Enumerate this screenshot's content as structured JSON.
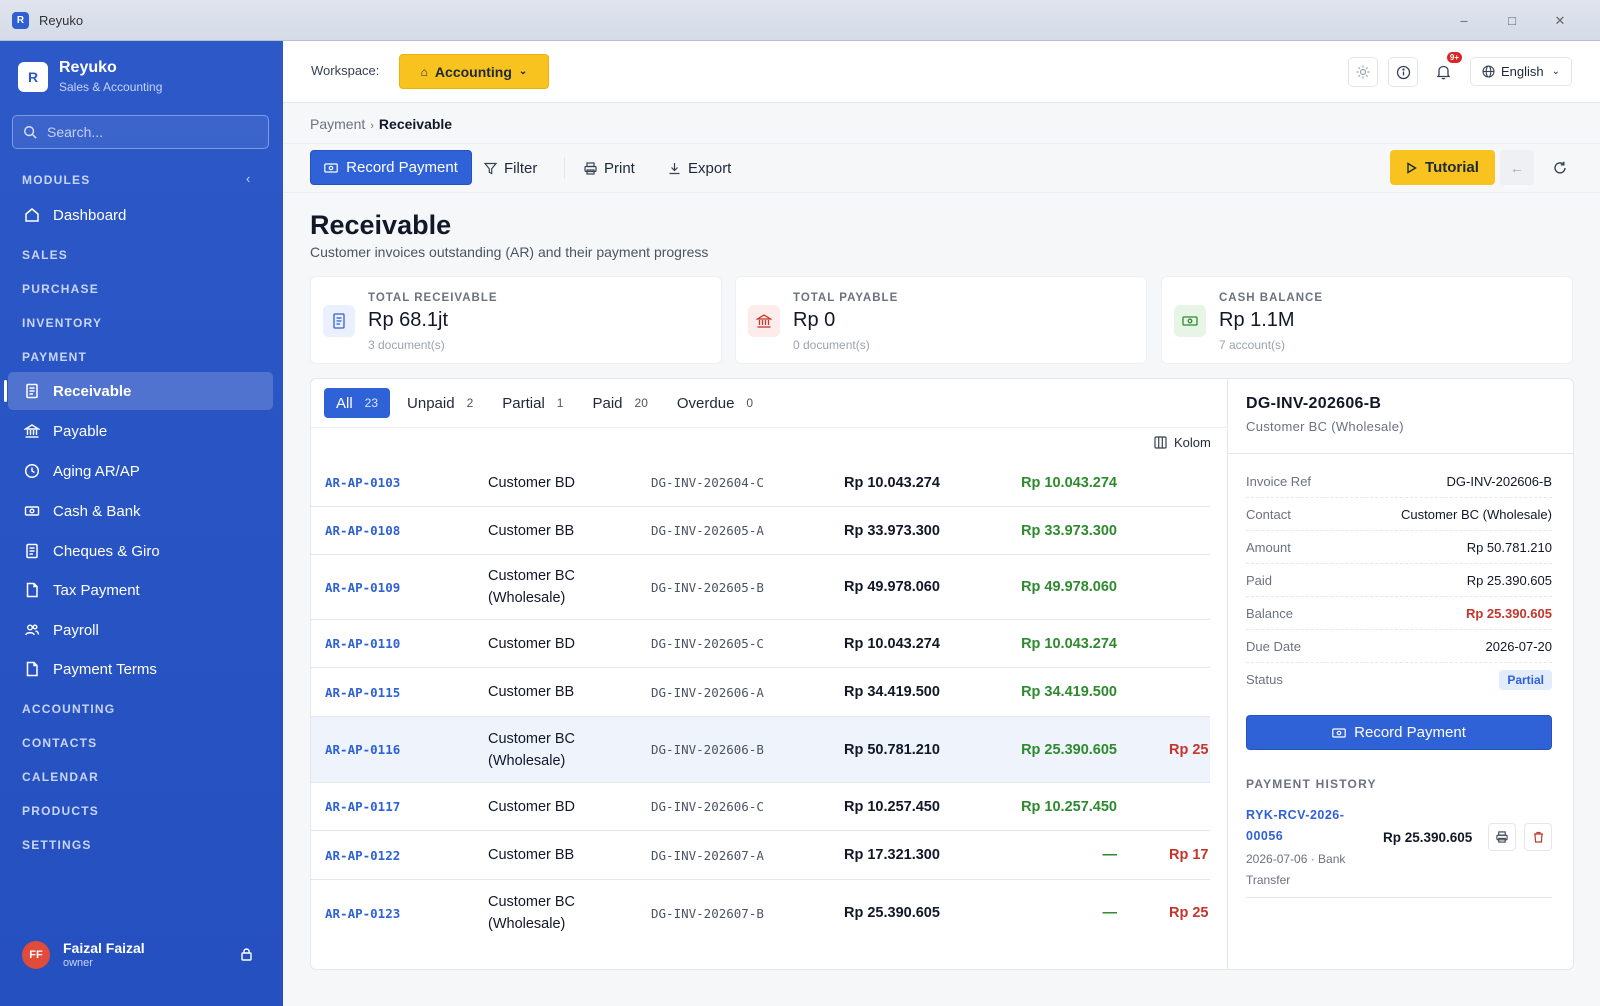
{
  "window": {
    "title": "Reyuko",
    "icon_letter": "R"
  },
  "brand": {
    "logo_letter": "R",
    "name": "Reyuko",
    "subtitle": "Sales & Accounting"
  },
  "search": {
    "placeholder": "Search..."
  },
  "sidebar": {
    "sections": {
      "modules": "MODULES",
      "sales": "SALES",
      "purchase": "PURCHASE",
      "inventory": "INVENTORY",
      "payment": "PAYMENT",
      "accounting": "ACCOUNTING",
      "contacts": "CONTACTS",
      "calendar": "CALENDAR",
      "products": "PRODUCTS",
      "settings": "SETTINGS"
    },
    "items": [
      {
        "label": "Dashboard",
        "icon": "home-icon"
      },
      {
        "label": "Receivable",
        "icon": "receipt-icon",
        "active": true
      },
      {
        "label": "Payable",
        "icon": "bank-icon"
      },
      {
        "label": "Aging AR/AP",
        "icon": "clock-icon"
      },
      {
        "label": "Cash & Bank",
        "icon": "cash-icon"
      },
      {
        "label": "Cheques & Giro",
        "icon": "receipt-icon"
      },
      {
        "label": "Tax Payment",
        "icon": "document-icon"
      },
      {
        "label": "Payroll",
        "icon": "users-icon"
      },
      {
        "label": "Payment Terms",
        "icon": "document-icon"
      }
    ]
  },
  "user": {
    "initials": "FF",
    "name": "Faizal Faizal",
    "role": "owner"
  },
  "header": {
    "workspace_label": "Workspace:",
    "workspace_value": "Accounting",
    "language": "English",
    "notification_badge": "9+"
  },
  "breadcrumb": {
    "parent": "Payment",
    "current": "Receivable"
  },
  "toolbar": {
    "record_payment": "Record Payment",
    "filter": "Filter",
    "print": "Print",
    "export": "Export",
    "tutorial": "Tutorial"
  },
  "page": {
    "title": "Receivable",
    "subtitle": "Customer invoices outstanding (AR) and their payment progress"
  },
  "stats": [
    {
      "label": "TOTAL RECEIVABLE",
      "value": "Rp 68.1jt",
      "sub": "3 document(s)",
      "color": "#2f62d6"
    },
    {
      "label": "TOTAL PAYABLE",
      "value": "Rp 0",
      "sub": "0 document(s)",
      "color": "#c2362b"
    },
    {
      "label": "CASH BALANCE",
      "value": "Rp 1.1M",
      "sub": "7 account(s)",
      "color": "#2f8a2f"
    }
  ],
  "tabs": [
    {
      "label": "All",
      "count": "23",
      "active": true
    },
    {
      "label": "Unpaid",
      "count": "2"
    },
    {
      "label": "Partial",
      "count": "1"
    },
    {
      "label": "Paid",
      "count": "20"
    },
    {
      "label": "Overdue",
      "count": "0"
    }
  ],
  "kolom_label": "Kolom",
  "rows": [
    {
      "code": "AR-AP-0103",
      "customer": "Customer BD",
      "ref": "DG-INV-202604-C",
      "amount": "Rp 10.043.274",
      "paid": "Rp 10.043.274",
      "balance": ""
    },
    {
      "code": "AR-AP-0108",
      "customer": "Customer BB",
      "ref": "DG-INV-202605-A",
      "amount": "Rp 33.973.300",
      "paid": "Rp 33.973.300",
      "balance": ""
    },
    {
      "code": "AR-AP-0109",
      "customer": "Customer BC (Wholesale)",
      "ref": "DG-INV-202605-B",
      "amount": "Rp 49.978.060",
      "paid": "Rp 49.978.060",
      "balance": ""
    },
    {
      "code": "AR-AP-0110",
      "customer": "Customer BD",
      "ref": "DG-INV-202605-C",
      "amount": "Rp 10.043.274",
      "paid": "Rp 10.043.274",
      "balance": ""
    },
    {
      "code": "AR-AP-0115",
      "customer": "Customer BB",
      "ref": "DG-INV-202606-A",
      "amount": "Rp 34.419.500",
      "paid": "Rp 34.419.500",
      "balance": ""
    },
    {
      "code": "AR-AP-0116",
      "customer": "Customer BC (Wholesale)",
      "ref": "DG-INV-202606-B",
      "amount": "Rp 50.781.210",
      "paid": "Rp 25.390.605",
      "balance": "Rp 25",
      "selected": true
    },
    {
      "code": "AR-AP-0117",
      "customer": "Customer BD",
      "ref": "DG-INV-202606-C",
      "amount": "Rp 10.257.450",
      "paid": "Rp 10.257.450",
      "balance": ""
    },
    {
      "code": "AR-AP-0122",
      "customer": "Customer BB",
      "ref": "DG-INV-202607-A",
      "amount": "Rp 17.321.300",
      "paid": "—",
      "balance": "Rp 17"
    },
    {
      "code": "AR-AP-0123",
      "customer": "Customer BC (Wholesale)",
      "ref": "DG-INV-202607-B",
      "amount": "Rp 25.390.605",
      "paid": "—",
      "balance": "Rp 25"
    }
  ],
  "detail": {
    "title": "DG-INV-202606-B",
    "subtitle": "Customer BC (Wholesale)",
    "fields": [
      {
        "key": "Invoice Ref",
        "value": "DG-INV-202606-B"
      },
      {
        "key": "Contact",
        "value": "Customer BC (Wholesale)"
      },
      {
        "key": "Amount",
        "value": "Rp 50.781.210"
      },
      {
        "key": "Paid",
        "value": "Rp 25.390.605"
      },
      {
        "key": "Balance",
        "value": "Rp 25.390.605"
      },
      {
        "key": "Due Date",
        "value": "2026-07-20"
      },
      {
        "key": "Status",
        "value": "Partial"
      }
    ],
    "record_button": "Record Payment",
    "history_title": "PAYMENT HISTORY",
    "history": [
      {
        "code": "RYK-RCV-2026-00056",
        "meta": "2026-07-06 · Bank Transfer",
        "amount": "Rp 25.390.605"
      }
    ]
  }
}
